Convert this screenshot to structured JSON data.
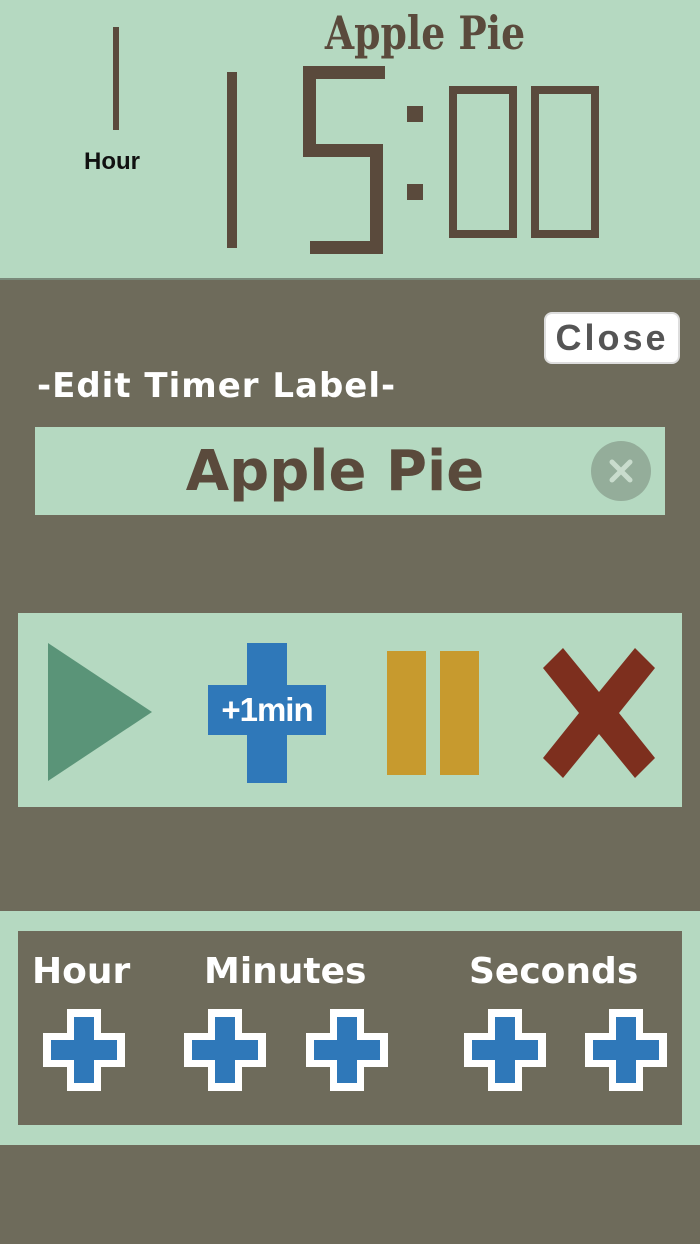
{
  "display": {
    "title": "Apple Pie",
    "hour_caption": "Hour",
    "hours": "1",
    "time": "15:00"
  },
  "edit": {
    "close_label": "Close",
    "heading": "-Edit Timer Label-",
    "label_value": "Apple Pie"
  },
  "controls": {
    "play_icon": "play-icon",
    "add_minute_label": "+1min",
    "pause_icon": "pause-icon",
    "cancel_icon": "x-icon"
  },
  "adjust": {
    "hour_label": "Hour",
    "minutes_label": "Minutes",
    "seconds_label": "Seconds"
  },
  "colors": {
    "panel_green": "#b5d9c1",
    "background": "#6e6b5b",
    "digit_brown": "#5a4a3c",
    "play_green": "#5a9478",
    "plus_blue": "#2f78b9",
    "pause_gold": "#c79a2e",
    "cancel_red": "#7d2f1e"
  }
}
